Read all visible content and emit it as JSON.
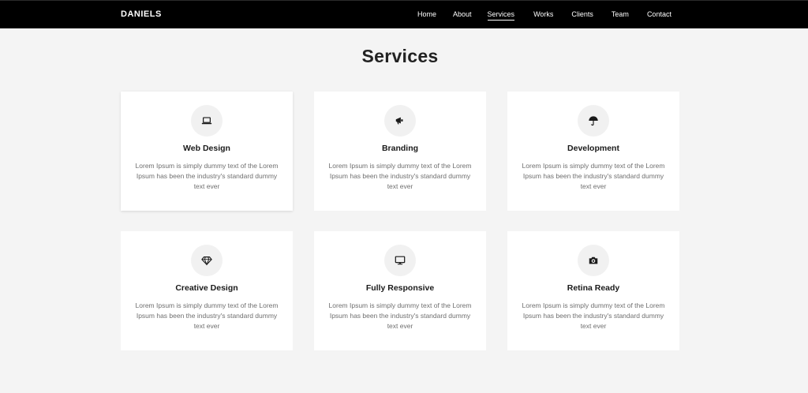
{
  "brand": "DANIELS",
  "nav": {
    "items": [
      "Home",
      "About",
      "Services",
      "Works",
      "Clients",
      "Team",
      "Contact"
    ],
    "active": "Services"
  },
  "section": {
    "title": "Services"
  },
  "services": [
    {
      "title": "Web Design",
      "icon": "laptop-icon",
      "text": "Lorem Ipsum is simply dummy text of the Lorem Ipsum has been the industry's standard dummy text ever"
    },
    {
      "title": "Branding",
      "icon": "megaphone-icon",
      "text": "Lorem Ipsum is simply dummy text of the Lorem Ipsum has been the industry's standard dummy text ever"
    },
    {
      "title": "Development",
      "icon": "umbrella-icon",
      "text": "Lorem Ipsum is simply dummy text of the Lorem Ipsum has been the industry's standard dummy text ever"
    },
    {
      "title": "Creative Design",
      "icon": "diamond-icon",
      "text": "Lorem Ipsum is simply dummy text of the Lorem Ipsum has been the industry's standard dummy text ever"
    },
    {
      "title": "Fully Responsive",
      "icon": "desktop-icon",
      "text": "Lorem Ipsum is simply dummy text of the Lorem Ipsum has been the industry's standard dummy text ever"
    },
    {
      "title": "Retina Ready",
      "icon": "camera-icon",
      "text": "Lorem Ipsum is simply dummy text of the Lorem Ipsum has been the industry's standard dummy text ever"
    }
  ]
}
